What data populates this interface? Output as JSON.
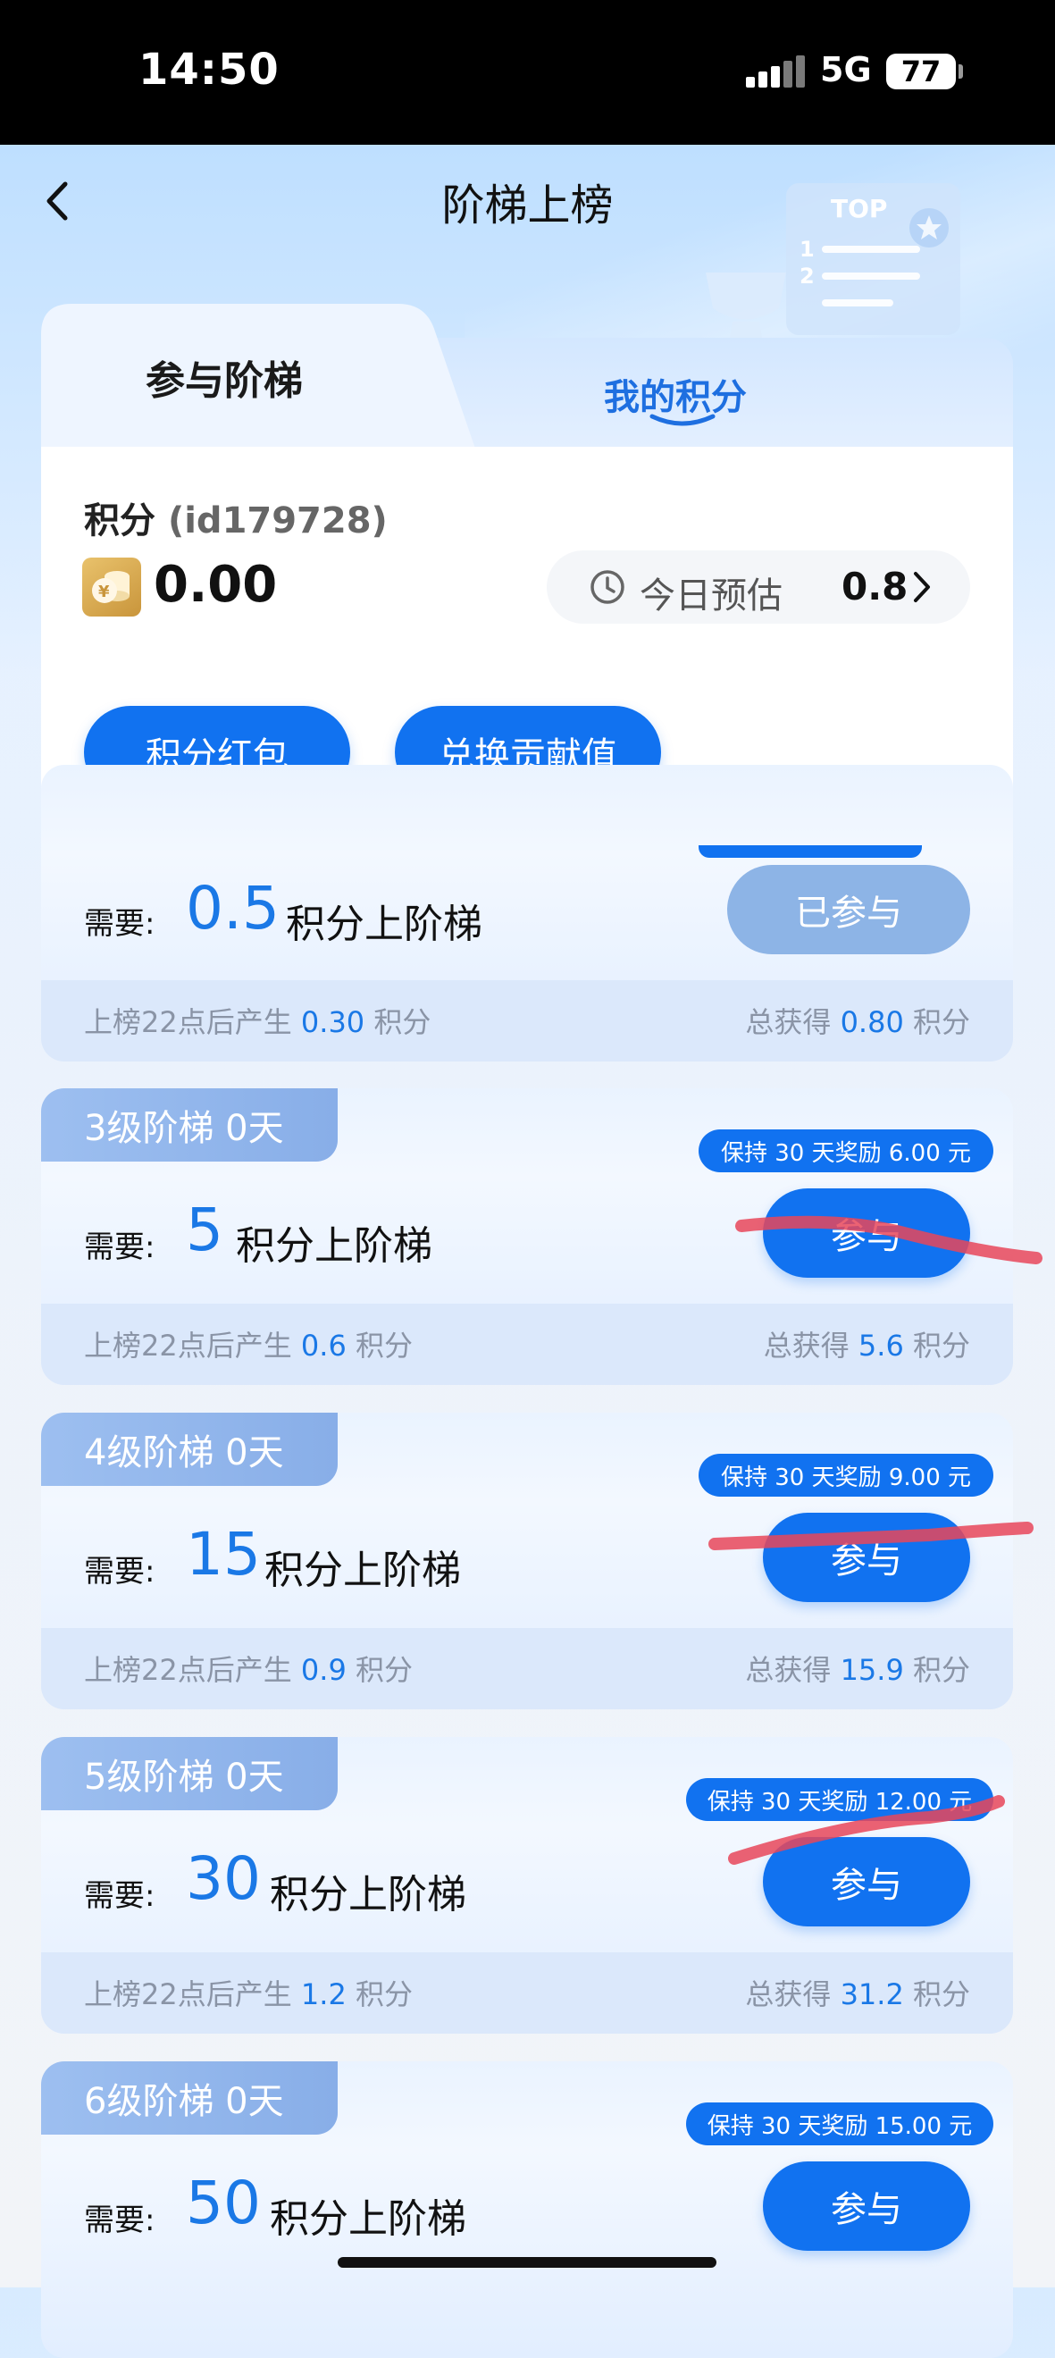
{
  "status_bar": {
    "time": "14:50",
    "network": "5G",
    "battery": "77"
  },
  "header": {
    "title": "阶梯上榜",
    "back_icon": "chevron-left-icon"
  },
  "tabs": {
    "participate": "参与阶梯",
    "my_points": "我的积分"
  },
  "points": {
    "label": "积分",
    "user_id": "(id179728)",
    "value": "0.00",
    "estimate_label": "今日预估",
    "estimate_value": "0.8",
    "redpacket_button": "积分红包",
    "exchange_button": "兑换贡献值"
  },
  "tiers": [
    {
      "badge": "",
      "need_label": "需要:",
      "need_value": "0.5",
      "need_suffix": "积分上阶梯",
      "button": "已参与",
      "reward": "",
      "footer_left_prefix": "上榜22点后产生",
      "footer_left_value": "0.30",
      "footer_left_unit": "积分",
      "footer_right_prefix": "总获得",
      "footer_right_value": "0.80",
      "footer_right_unit": "积分"
    },
    {
      "badge": "3级阶梯  0天",
      "need_label": "需要:",
      "need_value": "5",
      "need_suffix": "积分上阶梯",
      "button": "参与",
      "reward": "保持 30 天奖励 6.00 元",
      "footer_left_prefix": "上榜22点后产生",
      "footer_left_value": "0.6",
      "footer_left_unit": "积分",
      "footer_right_prefix": "总获得",
      "footer_right_value": "5.6",
      "footer_right_unit": "积分"
    },
    {
      "badge": "4级阶梯  0天",
      "need_label": "需要:",
      "need_value": "15",
      "need_suffix": "积分上阶梯",
      "button": "参与",
      "reward": "保持 30 天奖励 9.00 元",
      "footer_left_prefix": "上榜22点后产生",
      "footer_left_value": "0.9",
      "footer_left_unit": "积分",
      "footer_right_prefix": "总获得",
      "footer_right_value": "15.9",
      "footer_right_unit": "积分"
    },
    {
      "badge": "5级阶梯  0天",
      "need_label": "需要:",
      "need_value": "30",
      "need_suffix": "积分上阶梯",
      "button": "参与",
      "reward": "保持 30 天奖励 12.00 元",
      "footer_left_prefix": "上榜22点后产生",
      "footer_left_value": "1.2",
      "footer_left_unit": "积分",
      "footer_right_prefix": "总获得",
      "footer_right_value": "31.2",
      "footer_right_unit": "积分"
    },
    {
      "badge": "6级阶梯  0天",
      "need_label": "需要:",
      "need_value": "50",
      "need_suffix": "积分上阶梯",
      "button": "参与",
      "reward": "保持 30 天奖励 15.00 元",
      "footer_left_prefix": "",
      "footer_left_value": "",
      "footer_left_unit": "",
      "footer_right_prefix": "",
      "footer_right_value": "",
      "footer_right_unit": ""
    }
  ],
  "colors": {
    "primary": "#1172f0",
    "highlight_text": "#1a78e6",
    "badge": "#9dbff0",
    "joined_button": "#8db4e6",
    "scribble": "#e8475a"
  }
}
